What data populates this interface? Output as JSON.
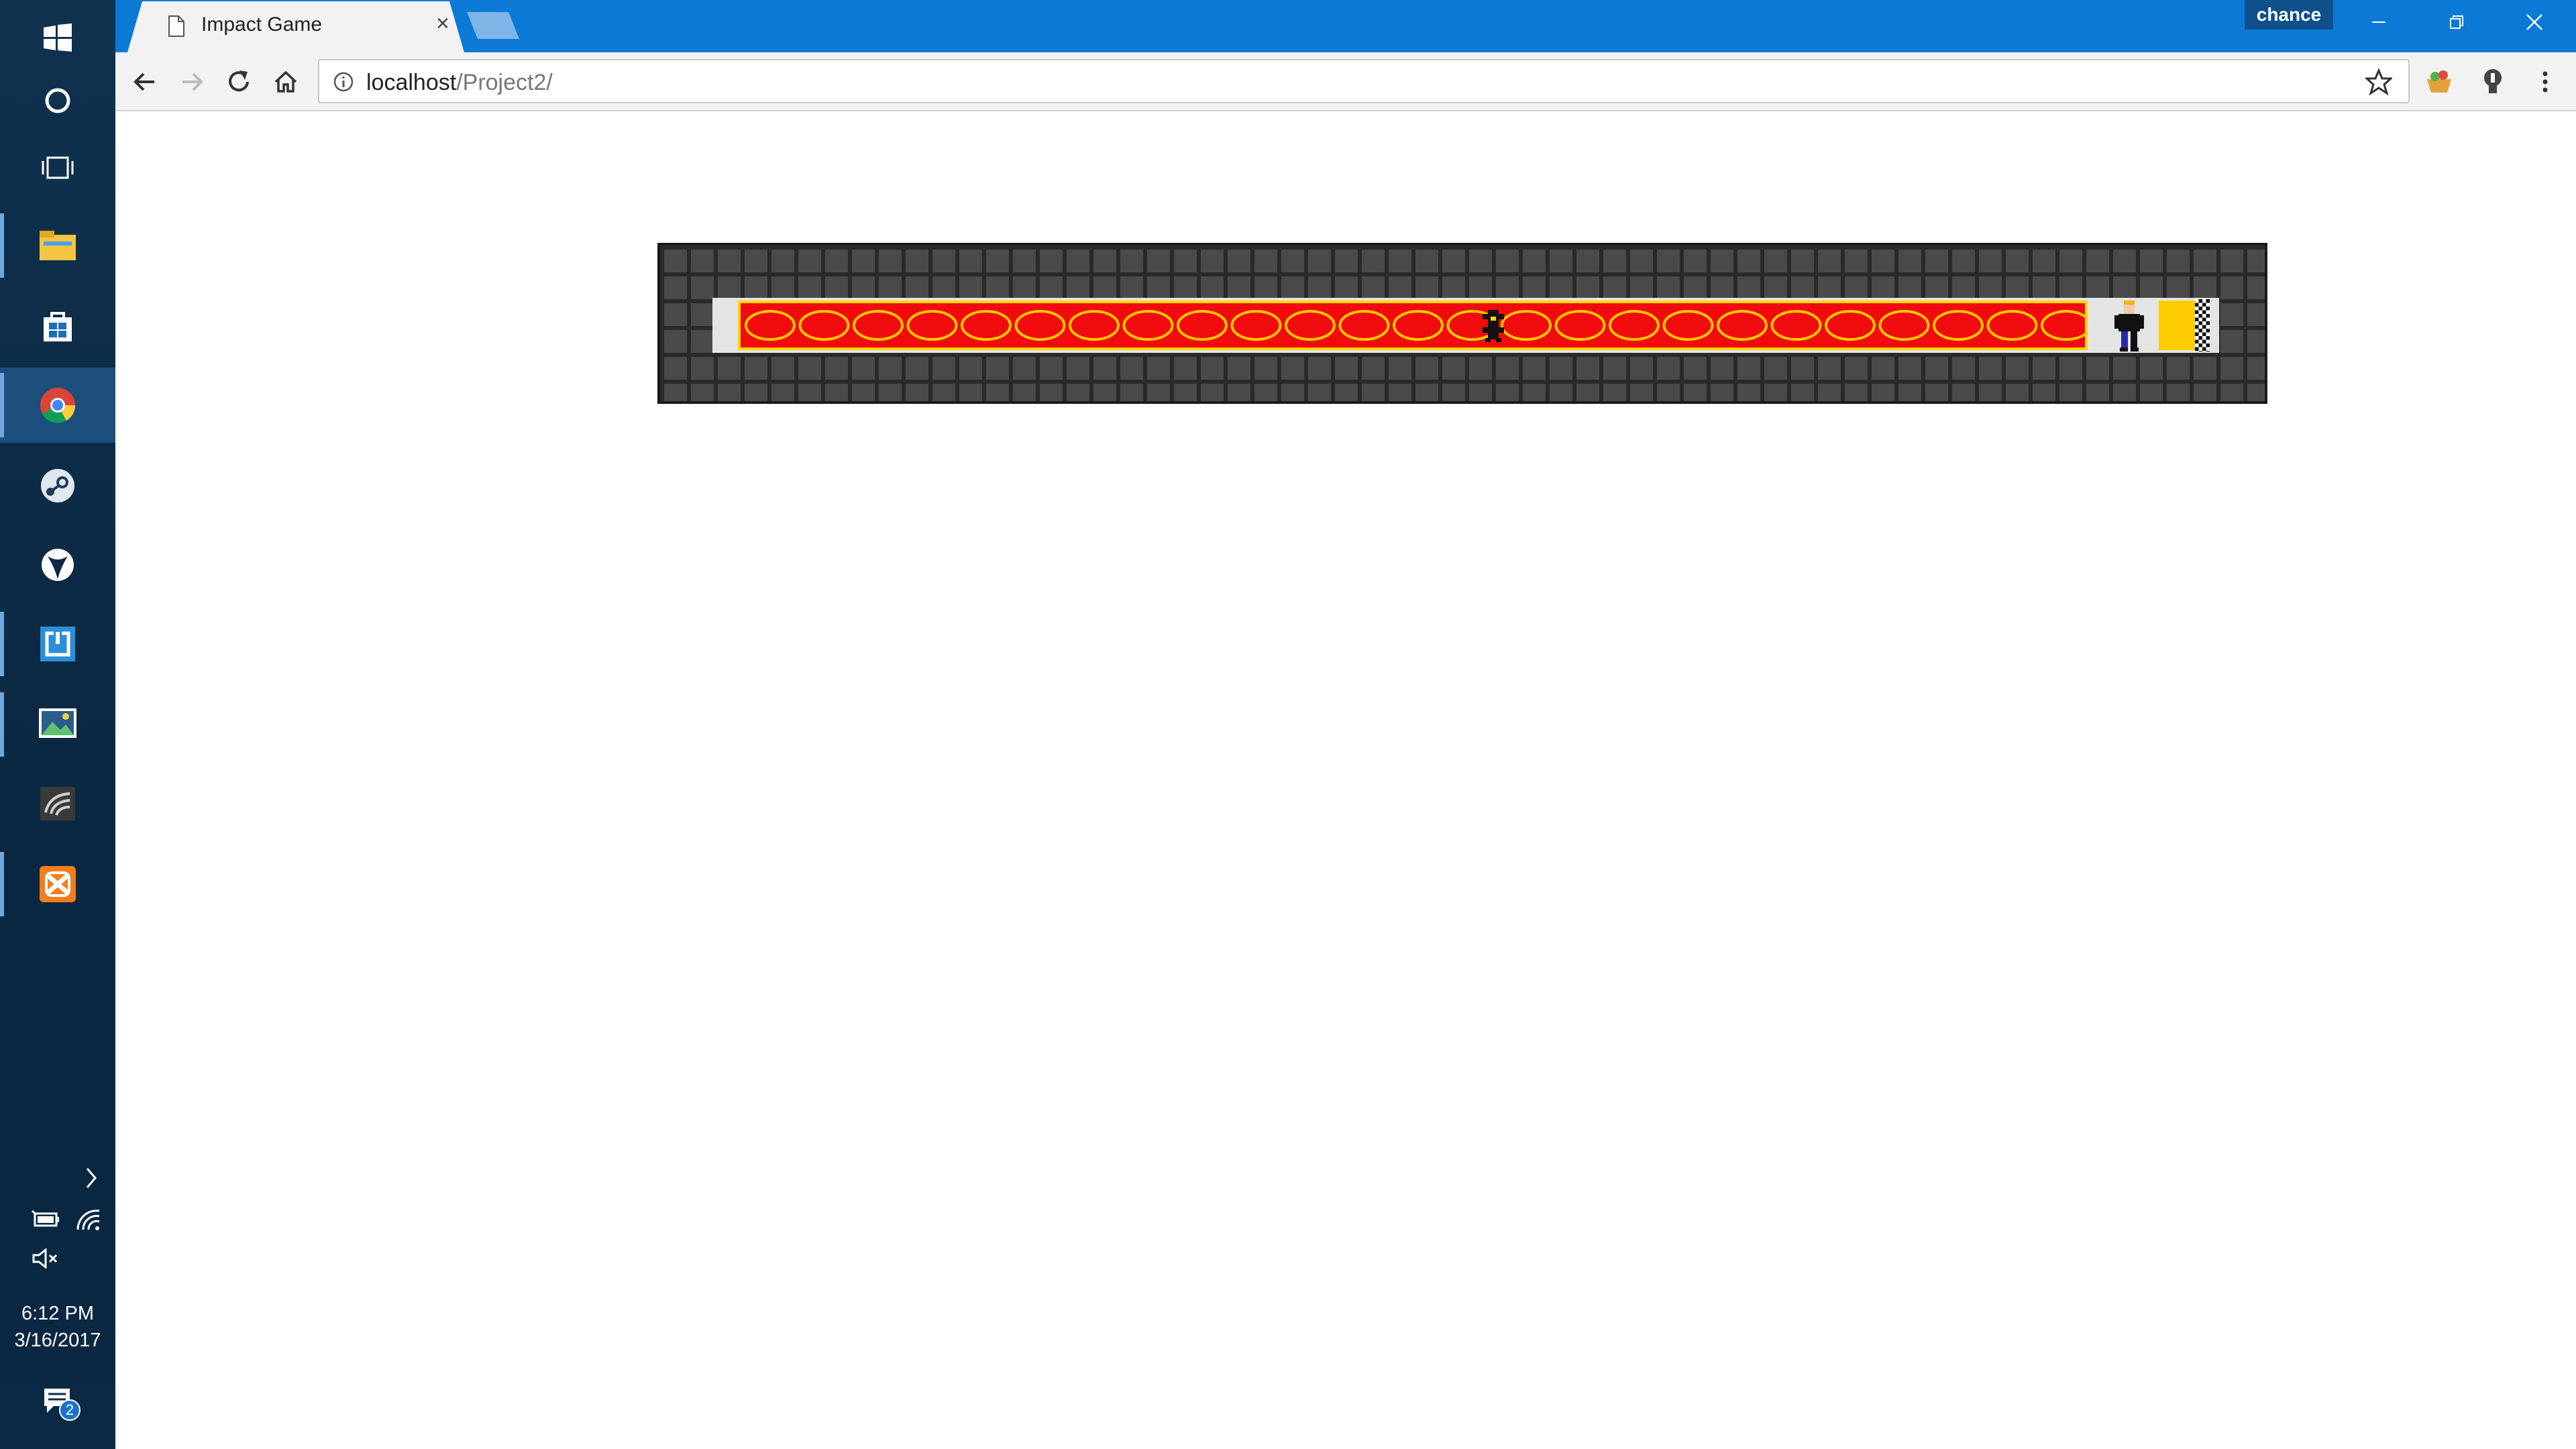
{
  "taskbar": {
    "icons": [
      {
        "name": "windows-start-icon"
      },
      {
        "name": "cortana-icon"
      },
      {
        "name": "task-view-icon"
      },
      {
        "name": "file-explorer-icon"
      },
      {
        "name": "store-icon"
      },
      {
        "name": "chrome-icon"
      },
      {
        "name": "steam-icon"
      },
      {
        "name": "xbox-icon"
      },
      {
        "name": "app-box-icon"
      },
      {
        "name": "photos-icon"
      },
      {
        "name": "nvidia-icon"
      },
      {
        "name": "xampp-icon"
      }
    ],
    "time": "6:12 PM",
    "date": "3/16/2017",
    "notification_count": "2"
  },
  "browser": {
    "tab_title": "Impact Game",
    "profile_name": "chance",
    "url_host": "localhost",
    "url_path": "/Project2/"
  },
  "colors": {
    "titlebar": "#0a7ad6",
    "lava": "#f00c0c",
    "lava_border": "#ffd800",
    "goal": "#ffcc00"
  }
}
